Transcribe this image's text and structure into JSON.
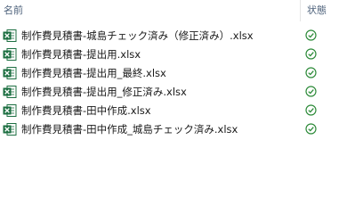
{
  "header": {
    "name_label": "名前",
    "status_label": "状態"
  },
  "files": [
    {
      "name": "制作費見積書-城島チェック済み（修正済み）.xlsx",
      "icon": "excel-file-icon",
      "status_icon": "sync-ok-icon"
    },
    {
      "name": "制作費見積書-提出用.xlsx",
      "icon": "excel-file-icon",
      "status_icon": "sync-ok-icon"
    },
    {
      "name": "制作費見積書-提出用_最終.xlsx",
      "icon": "excel-file-icon",
      "status_icon": "sync-ok-icon"
    },
    {
      "name": "制作費見積書-提出用_修正済み.xlsx",
      "icon": "excel-file-icon",
      "status_icon": "sync-ok-icon"
    },
    {
      "name": "制作費見積書-田中作成.xlsx",
      "icon": "excel-file-icon",
      "status_icon": "sync-ok-icon"
    },
    {
      "name": "制作費見積書-田中作成_城島チェック済み.xlsx",
      "icon": "excel-file-icon",
      "status_icon": "sync-ok-icon"
    }
  ],
  "colors": {
    "excel_green": "#1d6f42",
    "status_green": "#2e8b3a",
    "header_text": "#4c607a"
  }
}
